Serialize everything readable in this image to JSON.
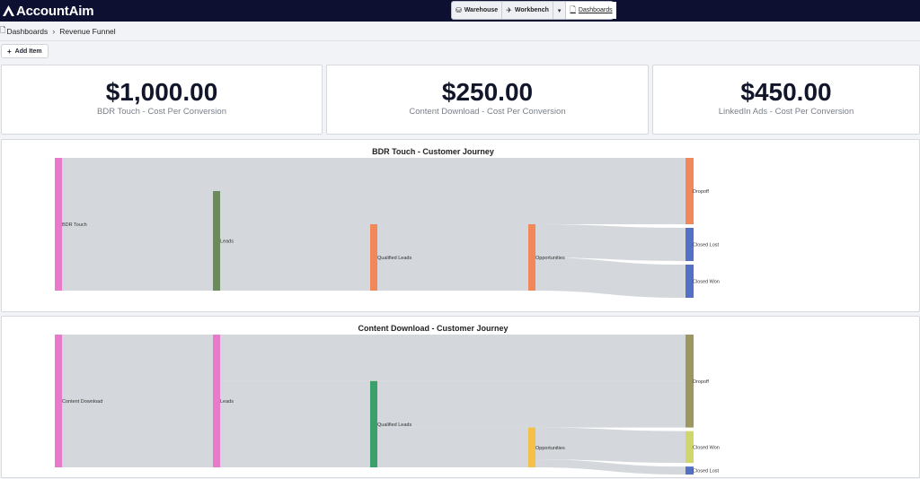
{
  "app": {
    "name": "AccountAim"
  },
  "nav": {
    "items": [
      {
        "label": "Warehouse",
        "icon": "database-icon"
      },
      {
        "label": "Workbench",
        "icon": "telescope-icon"
      },
      {
        "label": "Dashboards",
        "icon": "document-icon",
        "active": true
      }
    ]
  },
  "breadcrumb": {
    "root": "Dashboards",
    "current": "Revenue Funnel"
  },
  "toolbar": {
    "add_label": "Add Item"
  },
  "kpis": [
    {
      "value": "$1,000.00",
      "label": "BDR Touch - Cost Per Conversion"
    },
    {
      "value": "$250.00",
      "label": "Content Download - Cost Per Conversion"
    },
    {
      "value": "$450.00",
      "label": "LinkedIn Ads - Cost Per Conversion"
    }
  ],
  "chart_data": [
    {
      "type": "sankey",
      "title": "BDR Touch - Customer Journey",
      "nodes": [
        {
          "name": "BDR Touch",
          "color": "#e87ac9"
        },
        {
          "name": "Leads",
          "color": "#6b8b5a"
        },
        {
          "name": "Qualified Leads",
          "color": "#f0885a"
        },
        {
          "name": "Opportunities",
          "color": "#f0885a"
        },
        {
          "name": "Dropoff",
          "color": "#f0885a"
        },
        {
          "name": "Closed Lost",
          "color": "#5470c6"
        },
        {
          "name": "Closed Won",
          "color": "#5470c6"
        }
      ],
      "links": [
        {
          "source": "BDR Touch",
          "target": "Dropoff",
          "value": 25
        },
        {
          "source": "BDR Touch",
          "target": "Leads",
          "value": 75
        },
        {
          "source": "Leads",
          "target": "Dropoff",
          "value": 25
        },
        {
          "source": "Leads",
          "target": "Qualified Leads",
          "value": 50
        },
        {
          "source": "Qualified Leads",
          "target": "Opportunities",
          "value": 50
        },
        {
          "source": "Opportunities",
          "target": "Closed Lost",
          "value": 25
        },
        {
          "source": "Opportunities",
          "target": "Closed Won",
          "value": 25
        }
      ]
    },
    {
      "type": "sankey",
      "title": "Content Download - Customer Journey",
      "nodes": [
        {
          "name": "Content Download",
          "color": "#e87ac9"
        },
        {
          "name": "Leads",
          "color": "#e87ac9"
        },
        {
          "name": "Qualified Leads",
          "color": "#3ca06b"
        },
        {
          "name": "Opportunities",
          "color": "#f5c04a"
        },
        {
          "name": "Dropoff",
          "color": "#9c9660"
        },
        {
          "name": "Closed Won",
          "color": "#cfd66a"
        },
        {
          "name": "Closed Lost",
          "color": "#5470c6"
        }
      ],
      "links": [
        {
          "source": "Content Download",
          "target": "Leads",
          "value": 100
        },
        {
          "source": "Leads",
          "target": "Dropoff",
          "value": 35
        },
        {
          "source": "Leads",
          "target": "Qualified Leads",
          "value": 65
        },
        {
          "source": "Qualified Leads",
          "target": "Dropoff",
          "value": 35
        },
        {
          "source": "Qualified Leads",
          "target": "Opportunities",
          "value": 30
        },
        {
          "source": "Opportunities",
          "target": "Dropoff",
          "value": 0
        },
        {
          "source": "Opportunities",
          "target": "Closed Won",
          "value": 24
        },
        {
          "source": "Opportunities",
          "target": "Closed Lost",
          "value": 6
        }
      ]
    }
  ]
}
